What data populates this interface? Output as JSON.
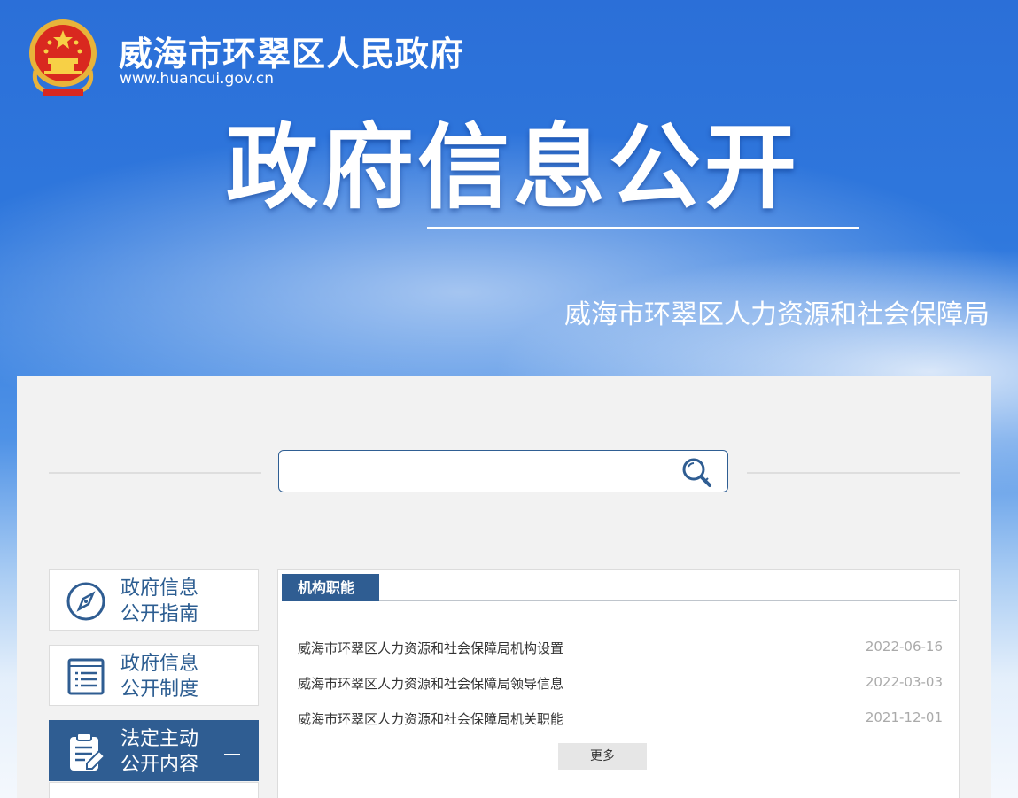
{
  "header": {
    "site_title": "威海市环翠区人民政府",
    "site_url": "www.huancui.gov.cn",
    "hero_title": "政府信息公开",
    "department": "威海市环翠区人力资源和社会保障局"
  },
  "search": {
    "value": "",
    "placeholder": ""
  },
  "sidebar": {
    "items": [
      {
        "line1": "政府信息",
        "line2": "公开指南",
        "icon": "compass-icon"
      },
      {
        "line1": "政府信息",
        "line2": "公开制度",
        "icon": "document-list-icon"
      },
      {
        "line1": "法定主动",
        "line2": "公开内容",
        "icon": "clipboard-edit-icon",
        "active": true
      }
    ]
  },
  "content": {
    "tab_label": "机构职能",
    "items": [
      {
        "title": "威海市环翠区人力资源和社会保障局机构设置",
        "date": "2022-06-16"
      },
      {
        "title": "威海市环翠区人力资源和社会保障局领导信息",
        "date": "2022-03-03"
      },
      {
        "title": "威海市环翠区人力资源和社会保障局机关职能",
        "date": "2021-12-01"
      }
    ],
    "more_label": "更多"
  },
  "colors": {
    "banner_blue": "#2b6fd8",
    "nav_blue": "#2f5d92",
    "panel_bg": "#f2f2f2"
  }
}
